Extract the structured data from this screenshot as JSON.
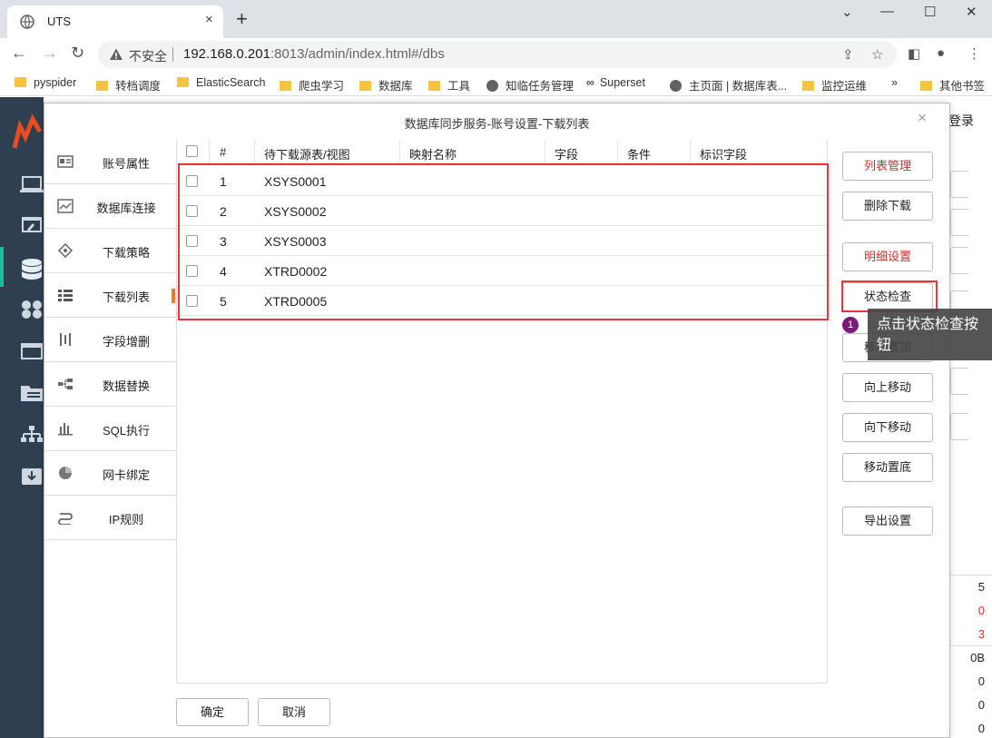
{
  "browser": {
    "tab_title": "UTS",
    "tab_close": "×",
    "new_tab": "+",
    "security_label": "不安全",
    "url_host": "192.168.0.201",
    "url_rest": ":8013/admin/index.html#/dbs",
    "bookmarks": [
      "pyspider",
      "转档调度",
      "ElasticSearch",
      "爬虫学习",
      "数据库",
      "工具",
      "知临任务管理",
      "Superset",
      "主页面 | 数据库表...",
      "监控运维"
    ],
    "bookmarks_more": "»",
    "other_bookmarks": "其他书签"
  },
  "app_background": {
    "login_label": "登录",
    "stats": [
      "5",
      "0",
      "3",
      "0B",
      "0",
      "0",
      "0"
    ],
    "stat_colors": [
      "#222222",
      "#d9302c",
      "#d9302c",
      "#222222",
      "#222222",
      "#222222",
      "#222222"
    ]
  },
  "modal": {
    "title": "数据库同步服务-账号设置-下载列表",
    "close": "×",
    "nav": [
      {
        "label": "账号属性",
        "icon": "id-card-icon"
      },
      {
        "label": "数据库连接",
        "icon": "chart-window-icon"
      },
      {
        "label": "下载策略",
        "icon": "diamond-icon"
      },
      {
        "label": "下载列表",
        "icon": "list-icon"
      },
      {
        "label": "字段增删",
        "icon": "columns-icon"
      },
      {
        "label": "数据替换",
        "icon": "swap-icon"
      },
      {
        "label": "SQL执行",
        "icon": "bar-chart-icon"
      },
      {
        "label": "网卡绑定",
        "icon": "pie-icon"
      },
      {
        "label": "IP规则",
        "icon": "route-icon"
      }
    ],
    "selected_nav": "下载列表",
    "table": {
      "headers": [
        "#",
        "待下载源表/视图",
        "映射名称",
        "字段",
        "条件",
        "标识字段"
      ],
      "rows": [
        {
          "num": "1",
          "name": "XSYS0001"
        },
        {
          "num": "2",
          "name": "XSYS0002"
        },
        {
          "num": "3",
          "name": "XSYS0003"
        },
        {
          "num": "4",
          "name": "XTRD0002"
        },
        {
          "num": "5",
          "name": "XTRD0005"
        }
      ]
    },
    "actions": {
      "list_manage": "列表管理",
      "delete_download": "删除下载",
      "detail_settings": "明细设置",
      "status_check": "状态检查",
      "move_top": "移动置顶",
      "move_up": "向上移动",
      "move_down": "向下移动",
      "move_bottom": "移动置底",
      "export_settings": "导出设置"
    },
    "tooltip": {
      "step": "1",
      "text": "点击状态检查按钮"
    },
    "footer": {
      "confirm": "确定",
      "cancel": "取消"
    }
  }
}
